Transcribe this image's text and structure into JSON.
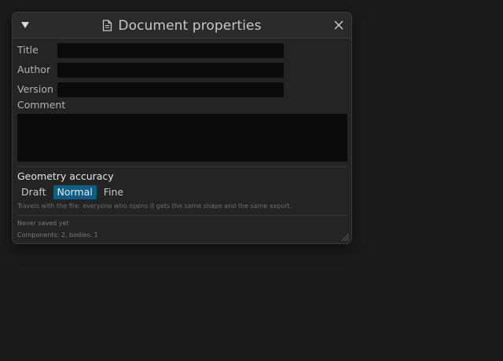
{
  "window": {
    "title": "Document properties",
    "title_icon": "document-icon",
    "collapse_icon": "triangle-down-icon",
    "close_icon": "close-icon"
  },
  "fields": {
    "title_label": "Title",
    "title_value": "",
    "author_label": "Author",
    "author_value": "",
    "version_label": "Version",
    "version_value": "",
    "comment_label": "Comment",
    "comment_value": ""
  },
  "geometry": {
    "heading": "Geometry accuracy",
    "options": [
      "Draft",
      "Normal",
      "Fine"
    ],
    "selected": "Normal",
    "hint": "Travels with the file: everyone who opens it gets the same shape and the same export."
  },
  "status": {
    "saved": "Never saved yet",
    "counts": "Components: 2, bodies: 1"
  },
  "colors": {
    "background": "#1b1b1b",
    "panel": "#242424",
    "field": "#0b0b0b",
    "selected": "#0e5d84"
  }
}
